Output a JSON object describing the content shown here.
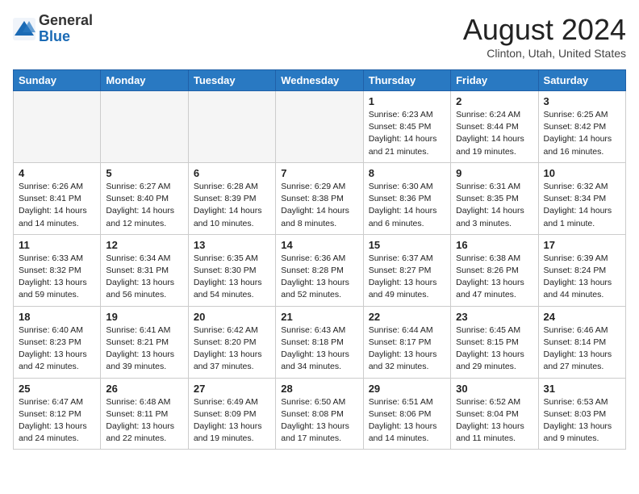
{
  "logo": {
    "general": "General",
    "blue": "Blue"
  },
  "title": {
    "month": "August 2024",
    "location": "Clinton, Utah, United States"
  },
  "weekdays": [
    "Sunday",
    "Monday",
    "Tuesday",
    "Wednesday",
    "Thursday",
    "Friday",
    "Saturday"
  ],
  "weeks": [
    [
      {
        "day": "",
        "info": ""
      },
      {
        "day": "",
        "info": ""
      },
      {
        "day": "",
        "info": ""
      },
      {
        "day": "",
        "info": ""
      },
      {
        "day": "1",
        "info": "Sunrise: 6:23 AM\nSunset: 8:45 PM\nDaylight: 14 hours\nand 21 minutes."
      },
      {
        "day": "2",
        "info": "Sunrise: 6:24 AM\nSunset: 8:44 PM\nDaylight: 14 hours\nand 19 minutes."
      },
      {
        "day": "3",
        "info": "Sunrise: 6:25 AM\nSunset: 8:42 PM\nDaylight: 14 hours\nand 16 minutes."
      }
    ],
    [
      {
        "day": "4",
        "info": "Sunrise: 6:26 AM\nSunset: 8:41 PM\nDaylight: 14 hours\nand 14 minutes."
      },
      {
        "day": "5",
        "info": "Sunrise: 6:27 AM\nSunset: 8:40 PM\nDaylight: 14 hours\nand 12 minutes."
      },
      {
        "day": "6",
        "info": "Sunrise: 6:28 AM\nSunset: 8:39 PM\nDaylight: 14 hours\nand 10 minutes."
      },
      {
        "day": "7",
        "info": "Sunrise: 6:29 AM\nSunset: 8:38 PM\nDaylight: 14 hours\nand 8 minutes."
      },
      {
        "day": "8",
        "info": "Sunrise: 6:30 AM\nSunset: 8:36 PM\nDaylight: 14 hours\nand 6 minutes."
      },
      {
        "day": "9",
        "info": "Sunrise: 6:31 AM\nSunset: 8:35 PM\nDaylight: 14 hours\nand 3 minutes."
      },
      {
        "day": "10",
        "info": "Sunrise: 6:32 AM\nSunset: 8:34 PM\nDaylight: 14 hours\nand 1 minute."
      }
    ],
    [
      {
        "day": "11",
        "info": "Sunrise: 6:33 AM\nSunset: 8:32 PM\nDaylight: 13 hours\nand 59 minutes."
      },
      {
        "day": "12",
        "info": "Sunrise: 6:34 AM\nSunset: 8:31 PM\nDaylight: 13 hours\nand 56 minutes."
      },
      {
        "day": "13",
        "info": "Sunrise: 6:35 AM\nSunset: 8:30 PM\nDaylight: 13 hours\nand 54 minutes."
      },
      {
        "day": "14",
        "info": "Sunrise: 6:36 AM\nSunset: 8:28 PM\nDaylight: 13 hours\nand 52 minutes."
      },
      {
        "day": "15",
        "info": "Sunrise: 6:37 AM\nSunset: 8:27 PM\nDaylight: 13 hours\nand 49 minutes."
      },
      {
        "day": "16",
        "info": "Sunrise: 6:38 AM\nSunset: 8:26 PM\nDaylight: 13 hours\nand 47 minutes."
      },
      {
        "day": "17",
        "info": "Sunrise: 6:39 AM\nSunset: 8:24 PM\nDaylight: 13 hours\nand 44 minutes."
      }
    ],
    [
      {
        "day": "18",
        "info": "Sunrise: 6:40 AM\nSunset: 8:23 PM\nDaylight: 13 hours\nand 42 minutes."
      },
      {
        "day": "19",
        "info": "Sunrise: 6:41 AM\nSunset: 8:21 PM\nDaylight: 13 hours\nand 39 minutes."
      },
      {
        "day": "20",
        "info": "Sunrise: 6:42 AM\nSunset: 8:20 PM\nDaylight: 13 hours\nand 37 minutes."
      },
      {
        "day": "21",
        "info": "Sunrise: 6:43 AM\nSunset: 8:18 PM\nDaylight: 13 hours\nand 34 minutes."
      },
      {
        "day": "22",
        "info": "Sunrise: 6:44 AM\nSunset: 8:17 PM\nDaylight: 13 hours\nand 32 minutes."
      },
      {
        "day": "23",
        "info": "Sunrise: 6:45 AM\nSunset: 8:15 PM\nDaylight: 13 hours\nand 29 minutes."
      },
      {
        "day": "24",
        "info": "Sunrise: 6:46 AM\nSunset: 8:14 PM\nDaylight: 13 hours\nand 27 minutes."
      }
    ],
    [
      {
        "day": "25",
        "info": "Sunrise: 6:47 AM\nSunset: 8:12 PM\nDaylight: 13 hours\nand 24 minutes."
      },
      {
        "day": "26",
        "info": "Sunrise: 6:48 AM\nSunset: 8:11 PM\nDaylight: 13 hours\nand 22 minutes."
      },
      {
        "day": "27",
        "info": "Sunrise: 6:49 AM\nSunset: 8:09 PM\nDaylight: 13 hours\nand 19 minutes."
      },
      {
        "day": "28",
        "info": "Sunrise: 6:50 AM\nSunset: 8:08 PM\nDaylight: 13 hours\nand 17 minutes."
      },
      {
        "day": "29",
        "info": "Sunrise: 6:51 AM\nSunset: 8:06 PM\nDaylight: 13 hours\nand 14 minutes."
      },
      {
        "day": "30",
        "info": "Sunrise: 6:52 AM\nSunset: 8:04 PM\nDaylight: 13 hours\nand 11 minutes."
      },
      {
        "day": "31",
        "info": "Sunrise: 6:53 AM\nSunset: 8:03 PM\nDaylight: 13 hours\nand 9 minutes."
      }
    ]
  ]
}
